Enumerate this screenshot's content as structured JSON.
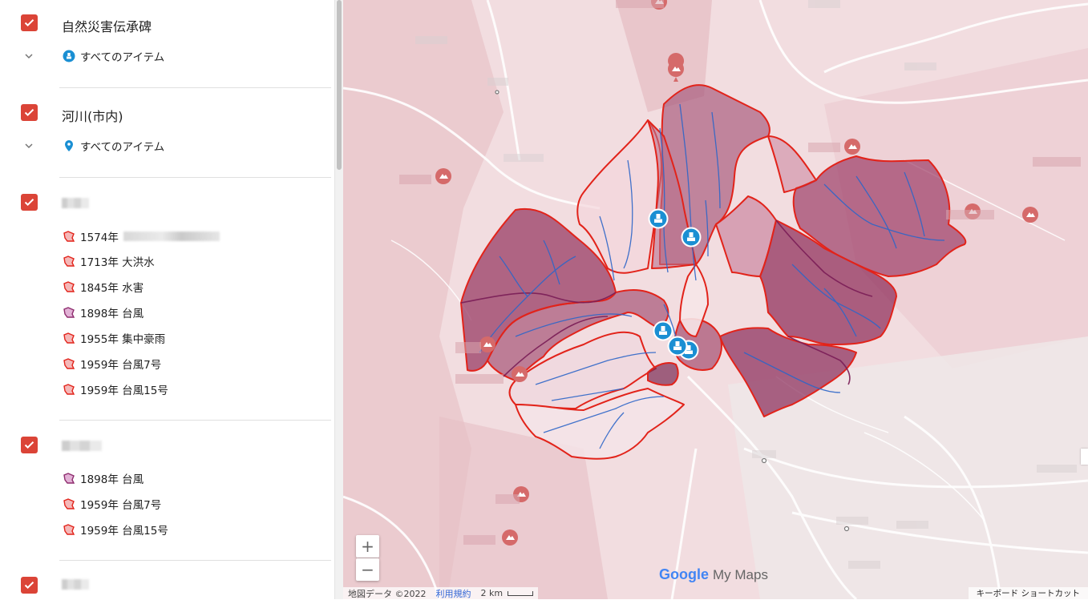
{
  "sidebar": {
    "layers": [
      {
        "title": "自然災害伝承碑",
        "expand_label": "すべてのアイテム",
        "icon": "monument-marker-icon"
      },
      {
        "title": "河川(市内)",
        "expand_label": "すべてのアイテム",
        "icon": "blue-pin-icon"
      },
      {
        "title": "",
        "items": [
          {
            "label": "1574年",
            "icon": "polygon-icon-red"
          },
          {
            "label": "1713年 大洪水",
            "icon": "polygon-icon-red"
          },
          {
            "label": "1845年 水害",
            "icon": "polygon-icon-red"
          },
          {
            "label": "1898年 台風",
            "icon": "polygon-icon-purple"
          },
          {
            "label": "1955年 集中豪雨",
            "icon": "polygon-icon-red"
          },
          {
            "label": "1959年 台風7号",
            "icon": "polygon-icon-red"
          },
          {
            "label": "1959年 台風15号",
            "icon": "polygon-icon-red"
          }
        ]
      },
      {
        "title": "",
        "items": [
          {
            "label": "1898年 台風",
            "icon": "polygon-icon-purple"
          },
          {
            "label": "1959年 台風7号",
            "icon": "polygon-icon-red"
          },
          {
            "label": "1959年 台風15号",
            "icon": "polygon-icon-red"
          }
        ]
      },
      {
        "title": ""
      }
    ]
  },
  "map": {
    "zoom_in": "+",
    "zoom_out": "−",
    "logo_google": "Google",
    "logo_product": "My Maps",
    "attribution": "地図データ ©2022",
    "terms": "利用規約",
    "scale": "2 km",
    "shortcuts": "キーボード ショートカット"
  },
  "colors": {
    "accent": "#db4437",
    "monument": "#1a8fd3",
    "polygon_fill": "#a0486c",
    "polygon_stroke": "#e2231a",
    "river": "#2e66c8",
    "peak_marker": "#d56a6a"
  }
}
